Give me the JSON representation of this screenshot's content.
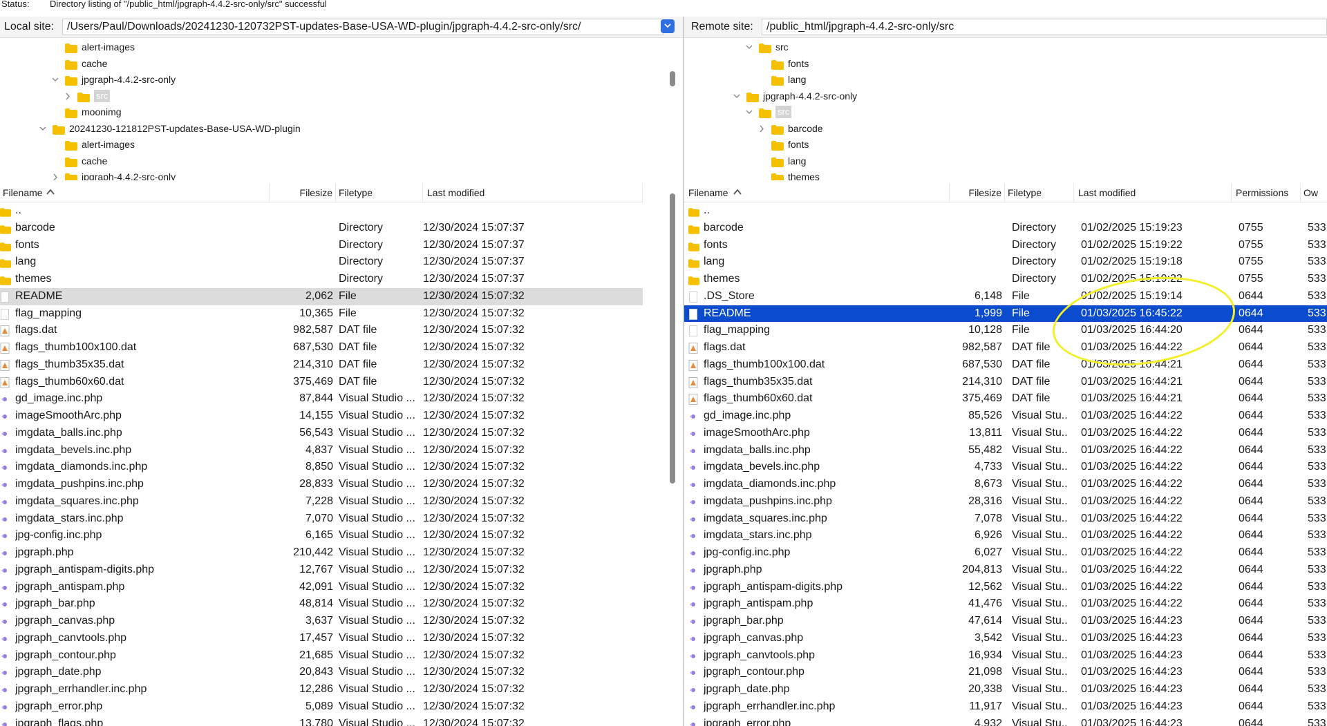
{
  "status": {
    "label": "Status:",
    "message": "Directory listing of \"/public_html/jpgraph-4.4.2-src-only/src\" successful"
  },
  "local": {
    "site_label": "Local site:",
    "path": "/Users/Paul/Downloads/20241230-120732PST-updates-Base-USA-WD-plugin/jpgraph-4.4.2-src-only/src/",
    "tree": [
      {
        "name": "alert-images",
        "level": 3,
        "chev": "none"
      },
      {
        "name": "cache",
        "level": 3,
        "chev": "none"
      },
      {
        "name": "jpgraph-4.4.2-src-only",
        "level": 3,
        "chev": "down"
      },
      {
        "name": "src",
        "level": 4,
        "chev": "right",
        "selected": true
      },
      {
        "name": "moonimg",
        "level": 3,
        "chev": "none"
      },
      {
        "name": "20241230-121812PST-updates-Base-USA-WD-plugin",
        "level": 2,
        "chev": "down"
      },
      {
        "name": "alert-images",
        "level": 3,
        "chev": "none"
      },
      {
        "name": "cache",
        "level": 3,
        "chev": "none"
      },
      {
        "name": "jpgraph-4.4.2-src-only",
        "level": 3,
        "chev": "right"
      }
    ],
    "headers": {
      "filename": "Filename",
      "filesize": "Filesize",
      "filetype": "Filetype",
      "modified": "Last modified"
    },
    "files": [
      {
        "name": "..",
        "size": "",
        "type": "",
        "modified": "",
        "icon": "folder"
      },
      {
        "name": "barcode",
        "size": "",
        "type": "Directory",
        "modified": "12/30/2024 15:07:37",
        "icon": "folder"
      },
      {
        "name": "fonts",
        "size": "",
        "type": "Directory",
        "modified": "12/30/2024 15:07:37",
        "icon": "folder"
      },
      {
        "name": "lang",
        "size": "",
        "type": "Directory",
        "modified": "12/30/2024 15:07:37",
        "icon": "folder"
      },
      {
        "name": "themes",
        "size": "",
        "type": "Directory",
        "modified": "12/30/2024 15:07:37",
        "icon": "folder"
      },
      {
        "name": "README",
        "size": "2,062",
        "type": "File",
        "modified": "12/30/2024 15:07:32",
        "icon": "file",
        "highlight": "grey"
      },
      {
        "name": "flag_mapping",
        "size": "10,365",
        "type": "File",
        "modified": "12/30/2024 15:07:32",
        "icon": "file"
      },
      {
        "name": "flags.dat",
        "size": "982,587",
        "type": "DAT file",
        "modified": "12/30/2024 15:07:32",
        "icon": "dat"
      },
      {
        "name": "flags_thumb100x100.dat",
        "size": "687,530",
        "type": "DAT file",
        "modified": "12/30/2024 15:07:32",
        "icon": "dat"
      },
      {
        "name": "flags_thumb35x35.dat",
        "size": "214,310",
        "type": "DAT file",
        "modified": "12/30/2024 15:07:32",
        "icon": "dat"
      },
      {
        "name": "flags_thumb60x60.dat",
        "size": "375,469",
        "type": "DAT file",
        "modified": "12/30/2024 15:07:32",
        "icon": "dat"
      },
      {
        "name": "gd_image.inc.php",
        "size": "87,844",
        "type": "Visual Studio ...",
        "modified": "12/30/2024 15:07:32",
        "icon": "php"
      },
      {
        "name": "imageSmoothArc.php",
        "size": "14,155",
        "type": "Visual Studio ...",
        "modified": "12/30/2024 15:07:32",
        "icon": "php"
      },
      {
        "name": "imgdata_balls.inc.php",
        "size": "56,543",
        "type": "Visual Studio ...",
        "modified": "12/30/2024 15:07:32",
        "icon": "php"
      },
      {
        "name": "imgdata_bevels.inc.php",
        "size": "4,837",
        "type": "Visual Studio ...",
        "modified": "12/30/2024 15:07:32",
        "icon": "php"
      },
      {
        "name": "imgdata_diamonds.inc.php",
        "size": "8,850",
        "type": "Visual Studio ...",
        "modified": "12/30/2024 15:07:32",
        "icon": "php"
      },
      {
        "name": "imgdata_pushpins.inc.php",
        "size": "28,833",
        "type": "Visual Studio ...",
        "modified": "12/30/2024 15:07:32",
        "icon": "php"
      },
      {
        "name": "imgdata_squares.inc.php",
        "size": "7,228",
        "type": "Visual Studio ...",
        "modified": "12/30/2024 15:07:32",
        "icon": "php"
      },
      {
        "name": "imgdata_stars.inc.php",
        "size": "7,070",
        "type": "Visual Studio ...",
        "modified": "12/30/2024 15:07:32",
        "icon": "php"
      },
      {
        "name": "jpg-config.inc.php",
        "size": "6,165",
        "type": "Visual Studio ...",
        "modified": "12/30/2024 15:07:32",
        "icon": "php"
      },
      {
        "name": "jpgraph.php",
        "size": "210,442",
        "type": "Visual Studio ...",
        "modified": "12/30/2024 15:07:32",
        "icon": "php"
      },
      {
        "name": "jpgraph_antispam-digits.php",
        "size": "12,767",
        "type": "Visual Studio ...",
        "modified": "12/30/2024 15:07:32",
        "icon": "php"
      },
      {
        "name": "jpgraph_antispam.php",
        "size": "42,091",
        "type": "Visual Studio ...",
        "modified": "12/30/2024 15:07:32",
        "icon": "php"
      },
      {
        "name": "jpgraph_bar.php",
        "size": "48,814",
        "type": "Visual Studio ...",
        "modified": "12/30/2024 15:07:32",
        "icon": "php"
      },
      {
        "name": "jpgraph_canvas.php",
        "size": "3,637",
        "type": "Visual Studio ...",
        "modified": "12/30/2024 15:07:32",
        "icon": "php"
      },
      {
        "name": "jpgraph_canvtools.php",
        "size": "17,457",
        "type": "Visual Studio ...",
        "modified": "12/30/2024 15:07:32",
        "icon": "php"
      },
      {
        "name": "jpgraph_contour.php",
        "size": "21,685",
        "type": "Visual Studio ...",
        "modified": "12/30/2024 15:07:32",
        "icon": "php"
      },
      {
        "name": "jpgraph_date.php",
        "size": "20,843",
        "type": "Visual Studio ...",
        "modified": "12/30/2024 15:07:32",
        "icon": "php"
      },
      {
        "name": "jpgraph_errhandler.inc.php",
        "size": "12,286",
        "type": "Visual Studio ...",
        "modified": "12/30/2024 15:07:32",
        "icon": "php"
      },
      {
        "name": "jpgraph_error.php",
        "size": "5,089",
        "type": "Visual Studio ...",
        "modified": "12/30/2024 15:07:32",
        "icon": "php"
      },
      {
        "name": "jpgraph_flags.php",
        "size": "13,780",
        "type": "Visual Studio ...",
        "modified": "12/30/2024 15:07:32",
        "icon": "php"
      }
    ]
  },
  "remote": {
    "site_label": "Remote site:",
    "path": "/public_html/jpgraph-4.4.2-src-only/src",
    "tree": [
      {
        "name": "src",
        "level": 3,
        "chev": "down"
      },
      {
        "name": "fonts",
        "level": 4,
        "chev": "none"
      },
      {
        "name": "lang",
        "level": 4,
        "chev": "none"
      },
      {
        "name": "jpgraph-4.4.2-src-only",
        "level": 2,
        "chev": "down"
      },
      {
        "name": "src",
        "level": 3,
        "chev": "down",
        "selected": true
      },
      {
        "name": "barcode",
        "level": 4,
        "chev": "right"
      },
      {
        "name": "fonts",
        "level": 4,
        "chev": "none"
      },
      {
        "name": "lang",
        "level": 4,
        "chev": "none"
      },
      {
        "name": "themes",
        "level": 4,
        "chev": "none"
      }
    ],
    "headers": {
      "filename": "Filename",
      "filesize": "Filesize",
      "filetype": "Filetype",
      "modified": "Last modified",
      "permissions": "Permissions",
      "owner": "Ow"
    },
    "files": [
      {
        "name": "..",
        "size": "",
        "type": "",
        "modified": "",
        "perm": "",
        "owner": "",
        "icon": "folder"
      },
      {
        "name": "barcode",
        "size": "",
        "type": "Directory",
        "modified": "01/02/2025 15:19:23",
        "perm": "0755",
        "owner": "533",
        "icon": "folder"
      },
      {
        "name": "fonts",
        "size": "",
        "type": "Directory",
        "modified": "01/02/2025 15:19:22",
        "perm": "0755",
        "owner": "533",
        "icon": "folder"
      },
      {
        "name": "lang",
        "size": "",
        "type": "Directory",
        "modified": "01/02/2025 15:19:18",
        "perm": "0755",
        "owner": "533",
        "icon": "folder"
      },
      {
        "name": "themes",
        "size": "",
        "type": "Directory",
        "modified": "01/02/2025 15:19:22",
        "perm": "0755",
        "owner": "533",
        "icon": "folder"
      },
      {
        "name": ".DS_Store",
        "size": "6,148",
        "type": "File",
        "modified": "01/02/2025 15:19:14",
        "perm": "0644",
        "owner": "533",
        "icon": "file"
      },
      {
        "name": "README",
        "size": "1,999",
        "type": "File",
        "modified": "01/03/2025 16:45:22",
        "perm": "0644",
        "owner": "533",
        "icon": "file",
        "highlight": "blue"
      },
      {
        "name": "flag_mapping",
        "size": "10,128",
        "type": "File",
        "modified": "01/03/2025 16:44:20",
        "perm": "0644",
        "owner": "533",
        "icon": "file"
      },
      {
        "name": "flags.dat",
        "size": "982,587",
        "type": "DAT file",
        "modified": "01/03/2025 16:44:22",
        "perm": "0644",
        "owner": "533",
        "icon": "dat"
      },
      {
        "name": "flags_thumb100x100.dat",
        "size": "687,530",
        "type": "DAT file",
        "modified": "01/03/2025 16:44:21",
        "perm": "0644",
        "owner": "533",
        "icon": "dat"
      },
      {
        "name": "flags_thumb35x35.dat",
        "size": "214,310",
        "type": "DAT file",
        "modified": "01/03/2025 16:44:21",
        "perm": "0644",
        "owner": "533",
        "icon": "dat"
      },
      {
        "name": "flags_thumb60x60.dat",
        "size": "375,469",
        "type": "DAT file",
        "modified": "01/03/2025 16:44:21",
        "perm": "0644",
        "owner": "533",
        "icon": "dat"
      },
      {
        "name": "gd_image.inc.php",
        "size": "85,526",
        "type": "Visual Stu..",
        "modified": "01/03/2025 16:44:22",
        "perm": "0644",
        "owner": "533",
        "icon": "php"
      },
      {
        "name": "imageSmoothArc.php",
        "size": "13,811",
        "type": "Visual Stu..",
        "modified": "01/03/2025 16:44:22",
        "perm": "0644",
        "owner": "533",
        "icon": "php"
      },
      {
        "name": "imgdata_balls.inc.php",
        "size": "55,482",
        "type": "Visual Stu..",
        "modified": "01/03/2025 16:44:22",
        "perm": "0644",
        "owner": "533",
        "icon": "php"
      },
      {
        "name": "imgdata_bevels.inc.php",
        "size": "4,733",
        "type": "Visual Stu..",
        "modified": "01/03/2025 16:44:22",
        "perm": "0644",
        "owner": "533",
        "icon": "php"
      },
      {
        "name": "imgdata_diamonds.inc.php",
        "size": "8,673",
        "type": "Visual Stu..",
        "modified": "01/03/2025 16:44:22",
        "perm": "0644",
        "owner": "533",
        "icon": "php"
      },
      {
        "name": "imgdata_pushpins.inc.php",
        "size": "28,316",
        "type": "Visual Stu..",
        "modified": "01/03/2025 16:44:22",
        "perm": "0644",
        "owner": "533",
        "icon": "php"
      },
      {
        "name": "imgdata_squares.inc.php",
        "size": "7,078",
        "type": "Visual Stu..",
        "modified": "01/03/2025 16:44:22",
        "perm": "0644",
        "owner": "533",
        "icon": "php"
      },
      {
        "name": "imgdata_stars.inc.php",
        "size": "6,926",
        "type": "Visual Stu..",
        "modified": "01/03/2025 16:44:22",
        "perm": "0644",
        "owner": "533",
        "icon": "php"
      },
      {
        "name": "jpg-config.inc.php",
        "size": "6,027",
        "type": "Visual Stu..",
        "modified": "01/03/2025 16:44:22",
        "perm": "0644",
        "owner": "533",
        "icon": "php"
      },
      {
        "name": "jpgraph.php",
        "size": "204,813",
        "type": "Visual Stu..",
        "modified": "01/03/2025 16:44:22",
        "perm": "0644",
        "owner": "533",
        "icon": "php"
      },
      {
        "name": "jpgraph_antispam-digits.php",
        "size": "12,562",
        "type": "Visual Stu..",
        "modified": "01/03/2025 16:44:22",
        "perm": "0644",
        "owner": "533",
        "icon": "php"
      },
      {
        "name": "jpgraph_antispam.php",
        "size": "41,476",
        "type": "Visual Stu..",
        "modified": "01/03/2025 16:44:22",
        "perm": "0644",
        "owner": "533",
        "icon": "php"
      },
      {
        "name": "jpgraph_bar.php",
        "size": "47,614",
        "type": "Visual Stu..",
        "modified": "01/03/2025 16:44:23",
        "perm": "0644",
        "owner": "533",
        "icon": "php"
      },
      {
        "name": "jpgraph_canvas.php",
        "size": "3,542",
        "type": "Visual Stu..",
        "modified": "01/03/2025 16:44:23",
        "perm": "0644",
        "owner": "533",
        "icon": "php"
      },
      {
        "name": "jpgraph_canvtools.php",
        "size": "16,934",
        "type": "Visual Stu..",
        "modified": "01/03/2025 16:44:23",
        "perm": "0644",
        "owner": "533",
        "icon": "php"
      },
      {
        "name": "jpgraph_contour.php",
        "size": "21,098",
        "type": "Visual Stu..",
        "modified": "01/03/2025 16:44:23",
        "perm": "0644",
        "owner": "533",
        "icon": "php"
      },
      {
        "name": "jpgraph_date.php",
        "size": "20,338",
        "type": "Visual Stu..",
        "modified": "01/03/2025 16:44:23",
        "perm": "0644",
        "owner": "533",
        "icon": "php"
      },
      {
        "name": "jpgraph_errhandler.inc.php",
        "size": "11,917",
        "type": "Visual Stu..",
        "modified": "01/03/2025 16:44:23",
        "perm": "0644",
        "owner": "533",
        "icon": "php"
      },
      {
        "name": "jpgraph_error.php",
        "size": "4,932",
        "type": "Visual Stu..",
        "modified": "01/03/2025 16:44:23",
        "perm": "0644",
        "owner": "533",
        "icon": "php"
      }
    ]
  },
  "colors": {
    "folder": "#f5c000",
    "selection_blue": "#0a4ccd",
    "selection_grey": "#dcdcdc",
    "annotation": "#f2ef2a",
    "dropdown": "#2f6fe0",
    "php_icon": "#7a5ccf",
    "dat_icon": "#e58a3a"
  }
}
